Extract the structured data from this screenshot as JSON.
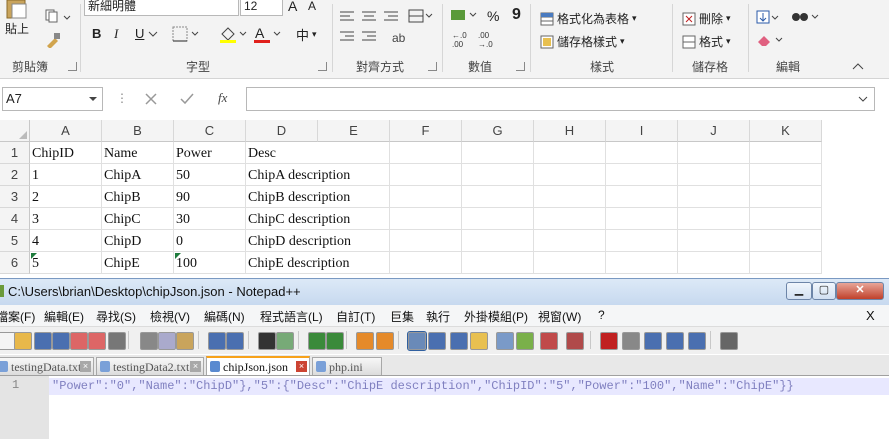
{
  "excel": {
    "ribbon": {
      "clipboard": {
        "paste": "貼上",
        "group": "剪貼簿"
      },
      "font": {
        "name": "新細明體",
        "size": "12",
        "grow": "A",
        "shrink": "A",
        "bold": "B",
        "italic": "I",
        "underline": "U",
        "phonetic": "中",
        "group": "字型"
      },
      "alignment": {
        "group": "對齊方式"
      },
      "number": {
        "percent": "%",
        "comma": "9",
        "inc": "←.0\n.00",
        "dec": ".00\n→.0",
        "group": "數值"
      },
      "styles": {
        "format_as_table": "格式化為表格",
        "cell_styles": "儲存格樣式",
        "group": "樣式"
      },
      "cells": {
        "delete": "刪除",
        "format": "格式",
        "group": "儲存格"
      },
      "editing": {
        "group": "編輯"
      }
    },
    "name_box": "A7",
    "formula_value": "",
    "fx": "fx",
    "columns": [
      "A",
      "B",
      "C",
      "D",
      "E",
      "F",
      "G",
      "H",
      "I",
      "J",
      "K"
    ],
    "rows": [
      {
        "num": "1",
        "cells": [
          "ChipID",
          "Name",
          "Power",
          "Desc"
        ]
      },
      {
        "num": "2",
        "cells": [
          "1",
          "ChipA",
          "50",
          "ChipA description"
        ]
      },
      {
        "num": "3",
        "cells": [
          "2",
          "ChipB",
          "90",
          "ChipB description"
        ]
      },
      {
        "num": "4",
        "cells": [
          "3",
          "ChipC",
          "30",
          "ChipC description"
        ]
      },
      {
        "num": "5",
        "cells": [
          "4",
          "ChipD",
          "0",
          "ChipD description"
        ]
      },
      {
        "num": "6",
        "cells": [
          "5",
          "ChipE",
          "100",
          "ChipE description"
        ]
      }
    ]
  },
  "notepad": {
    "title": "C:\\Users\\brian\\Desktop\\chipJson.json - Notepad++",
    "menu": [
      "檔案(F)",
      "編輯(E)",
      "尋找(S)",
      "檢視(V)",
      "編碼(N)",
      "程式語言(L)",
      "自訂(T)",
      "巨集",
      "執行",
      "外掛模組(P)",
      "視窗(W)",
      "?"
    ],
    "menu_close": "X",
    "tabs": [
      {
        "label": "testingData.txt",
        "active": false
      },
      {
        "label": "testingData2.txt",
        "active": false
      },
      {
        "label": "chipJson.json",
        "active": true
      },
      {
        "label": "php.ini",
        "active": false
      }
    ],
    "line_number": "1",
    "code": "\"Power\":\"0\",\"Name\":\"ChipD\"},\"5\":{\"Desc\":\"ChipE description\",\"ChipID\":\"5\",\"Power\":\"100\",\"Name\":\"ChipE\"}}"
  },
  "colors": {
    "excel_green": "#1e7b3c",
    "npp_title": "#c7d9ef",
    "npp_tab_accent": "#f7a21a"
  }
}
